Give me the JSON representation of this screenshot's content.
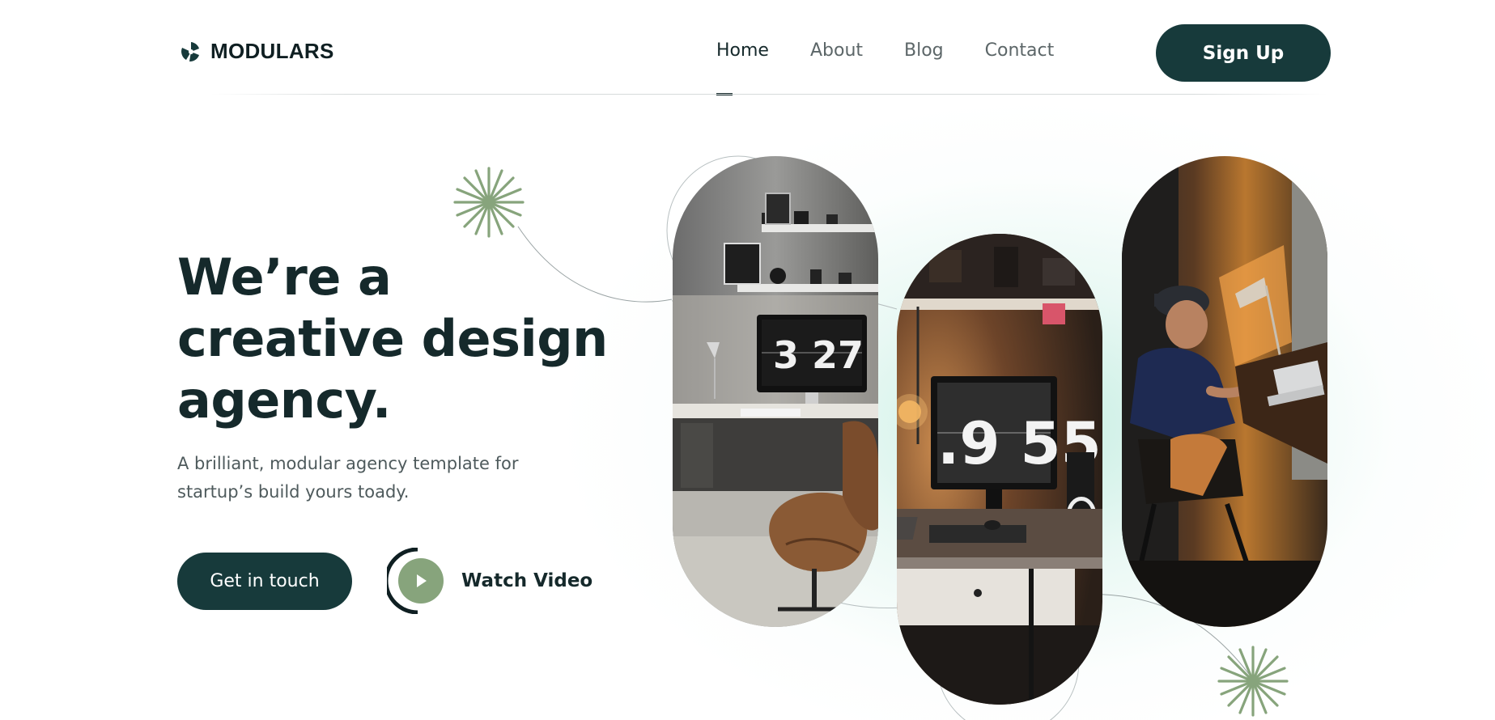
{
  "brand": {
    "name": "MODULARS",
    "icon": "propeller-logo-icon"
  },
  "nav": {
    "items": [
      {
        "label": "Home",
        "active": true
      },
      {
        "label": "About",
        "active": false
      },
      {
        "label": "Blog",
        "active": false
      },
      {
        "label": "Contact",
        "active": false
      }
    ]
  },
  "header": {
    "signup_label": "Sign Up"
  },
  "hero": {
    "headline_lines": [
      "We’re a",
      "creative design",
      "agency."
    ],
    "subtitle_lines": [
      "A brilliant, modular agency template for",
      "startup’s build yours toady."
    ],
    "cta_label": "Get in touch",
    "watch_label": "Watch Video",
    "watch_icon": "play-icon"
  },
  "gallery": {
    "clock_1": "3 27",
    "clock_2": ".9 55",
    "images": [
      "workspace-photo-grey-shelves",
      "workspace-photo-flip-clock-desk",
      "workspace-photo-man-at-laptop"
    ]
  },
  "colors": {
    "primary": "#173a3b",
    "accent_green": "#87a47c",
    "text_dark": "#15292b",
    "text_muted": "#5c6668",
    "glow": "#b2e8d8"
  }
}
